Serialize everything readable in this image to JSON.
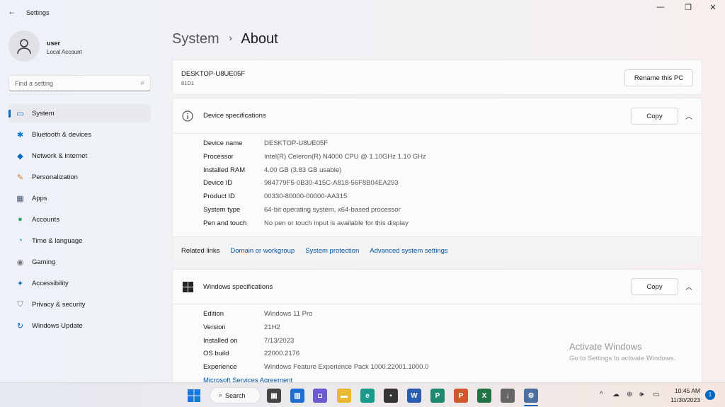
{
  "window": {
    "title": "Settings",
    "back_icon": "back-arrow-icon",
    "minimize": "—",
    "maximize": "❐",
    "close": "✕"
  },
  "user": {
    "name": "user",
    "type": "Local Account"
  },
  "search": {
    "placeholder": "Find a setting"
  },
  "sidebar": {
    "items": [
      {
        "label": "System",
        "icon": "▭",
        "color": "#0067c0",
        "selected": true
      },
      {
        "label": "Bluetooth & devices",
        "icon": "✱",
        "color": "#0078d4"
      },
      {
        "label": "Network & internet",
        "icon": "◆",
        "color": "#0067c0"
      },
      {
        "label": "Personalization",
        "icon": "✎",
        "color": "#d0752b"
      },
      {
        "label": "Apps",
        "icon": "▦",
        "color": "#4a5a7a"
      },
      {
        "label": "Accounts",
        "icon": "●",
        "color": "#2ba36a"
      },
      {
        "label": "Time & language",
        "icon": "◔",
        "color": "#1a8fd0"
      },
      {
        "label": "Gaming",
        "icon": "◉",
        "color": "#777"
      },
      {
        "label": "Accessibility",
        "icon": "✦",
        "color": "#1a6fb0"
      },
      {
        "label": "Privacy & security",
        "icon": "⛉",
        "color": "#777"
      },
      {
        "label": "Windows Update",
        "icon": "↻",
        "color": "#0067c0"
      }
    ]
  },
  "breadcrumb": {
    "parent": "System",
    "separator": "›",
    "current": "About"
  },
  "pc": {
    "name": "DESKTOP-U8UE05F",
    "model": "81D1",
    "rename_label": "Rename this PC"
  },
  "device_specs": {
    "title": "Device specifications",
    "copy_label": "Copy",
    "rows": [
      {
        "k": "Device name",
        "v": "DESKTOP-U8UE05F"
      },
      {
        "k": "Processor",
        "v": "Intel(R) Celeron(R) N4000 CPU @ 1.10GHz   1.10 GHz"
      },
      {
        "k": "Installed RAM",
        "v": "4.00 GB (3.83 GB usable)"
      },
      {
        "k": "Device ID",
        "v": "984779F5-0B30-415C-A818-56F8B04EA293"
      },
      {
        "k": "Product ID",
        "v": "00330-80000-00000-AA315"
      },
      {
        "k": "System type",
        "v": "64-bit operating system, x64-based processor"
      },
      {
        "k": "Pen and touch",
        "v": "No pen or touch input is available for this display"
      }
    ]
  },
  "related": {
    "label": "Related links",
    "links": [
      "Domain or workgroup",
      "System protection",
      "Advanced system settings"
    ]
  },
  "windows_specs": {
    "title": "Windows specifications",
    "copy_label": "Copy",
    "rows": [
      {
        "k": "Edition",
        "v": "Windows 11 Pro"
      },
      {
        "k": "Version",
        "v": "21H2"
      },
      {
        "k": "Installed on",
        "v": "7/13/2023"
      },
      {
        "k": "OS build",
        "v": "22000.2176"
      },
      {
        "k": "Experience",
        "v": "Windows Feature Experience Pack 1000.22001.1000.0"
      }
    ],
    "link": "Microsoft Services Agreement"
  },
  "watermark": {
    "title": "Activate Windows",
    "subtitle": "Go to Settings to activate Windows."
  },
  "taskbar": {
    "search_label": "Search",
    "time": "10:45 AM",
    "date": "11/30/2023",
    "notification_count": "1",
    "apps": [
      {
        "name": "task-view",
        "glyph": "▣",
        "bg": "#444"
      },
      {
        "name": "widgets",
        "glyph": "▥",
        "bg": "#1f6fd0"
      },
      {
        "name": "teams-chat",
        "glyph": "◘",
        "bg": "#6b5bd0"
      },
      {
        "name": "file-explorer",
        "glyph": "▬",
        "bg": "#e8b830"
      },
      {
        "name": "edge",
        "glyph": "e",
        "bg": "#1a9a8a"
      },
      {
        "name": "store",
        "glyph": "▪",
        "bg": "#333"
      },
      {
        "name": "word",
        "glyph": "W",
        "bg": "#2b5cb0"
      },
      {
        "name": "publisher",
        "glyph": "P",
        "bg": "#1f8a70"
      },
      {
        "name": "powerpoint",
        "glyph": "P",
        "bg": "#d2572e"
      },
      {
        "name": "excel",
        "glyph": "X",
        "bg": "#217346"
      },
      {
        "name": "installer",
        "glyph": "↓",
        "bg": "#666"
      },
      {
        "name": "settings",
        "glyph": "⚙",
        "bg": "#4a6fa0"
      }
    ],
    "tray": [
      "^",
      "☁",
      "⊕",
      "🕪",
      "▭"
    ]
  }
}
